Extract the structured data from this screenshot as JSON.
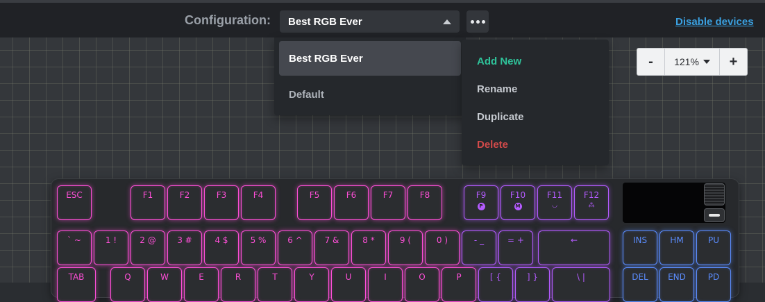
{
  "header": {
    "config_label": "Configuration:",
    "selected_config": "Best RGB Ever",
    "disable_link": "Disable devices"
  },
  "config_dropdown": {
    "options": [
      "Best RGB Ever",
      "Default"
    ]
  },
  "more_menu": {
    "items": [
      {
        "label": "Add New",
        "color": "#2fc39a"
      },
      {
        "label": "Rename",
        "color": "#c6cad0"
      },
      {
        "label": "Duplicate",
        "color": "#c6cad0"
      },
      {
        "label": "Delete",
        "color": "#d24a4a"
      }
    ]
  },
  "zoom": {
    "minus": "-",
    "value": "121%",
    "plus": "+"
  },
  "keyboard": {
    "colors": {
      "pink": "#ff4fd8",
      "purple": "#b45bff",
      "blue": "#5b8dff"
    },
    "rows": [
      [
        {
          "label": "ESC"
        },
        {
          "label": "F1"
        },
        {
          "label": "F2"
        },
        {
          "label": "F3"
        },
        {
          "label": "F4"
        },
        {
          "label": "F5"
        },
        {
          "label": "F6"
        },
        {
          "label": "F7"
        },
        {
          "label": "F8"
        },
        {
          "label": "F9",
          "badge": "P"
        },
        {
          "label": "F10",
          "badge": "M"
        },
        {
          "label": "F11",
          "sub": "◡"
        },
        {
          "label": "F12",
          "sub": "⁂"
        }
      ],
      [
        {
          "label": "` ~"
        },
        {
          "label": "1 !"
        },
        {
          "label": "2 @"
        },
        {
          "label": "3 #"
        },
        {
          "label": "4 $"
        },
        {
          "label": "5 %"
        },
        {
          "label": "6 ^"
        },
        {
          "label": "7 &"
        },
        {
          "label": "8 *"
        },
        {
          "label": "9 ("
        },
        {
          "label": "0 )"
        },
        {
          "label": "- _"
        },
        {
          "label": "= +"
        },
        {
          "label": "←"
        },
        {
          "label": "INS"
        },
        {
          "label": "HM"
        },
        {
          "label": "PU"
        }
      ],
      [
        {
          "label": "TAB"
        },
        {
          "label": "Q"
        },
        {
          "label": "W"
        },
        {
          "label": "E"
        },
        {
          "label": "R"
        },
        {
          "label": "T"
        },
        {
          "label": "Y"
        },
        {
          "label": "U"
        },
        {
          "label": "I"
        },
        {
          "label": "O"
        },
        {
          "label": "P"
        },
        {
          "label": "[ {"
        },
        {
          "label": "] }"
        },
        {
          "label": "\\ |"
        },
        {
          "label": "DEL"
        },
        {
          "label": "END"
        },
        {
          "label": "PD"
        }
      ]
    ]
  }
}
